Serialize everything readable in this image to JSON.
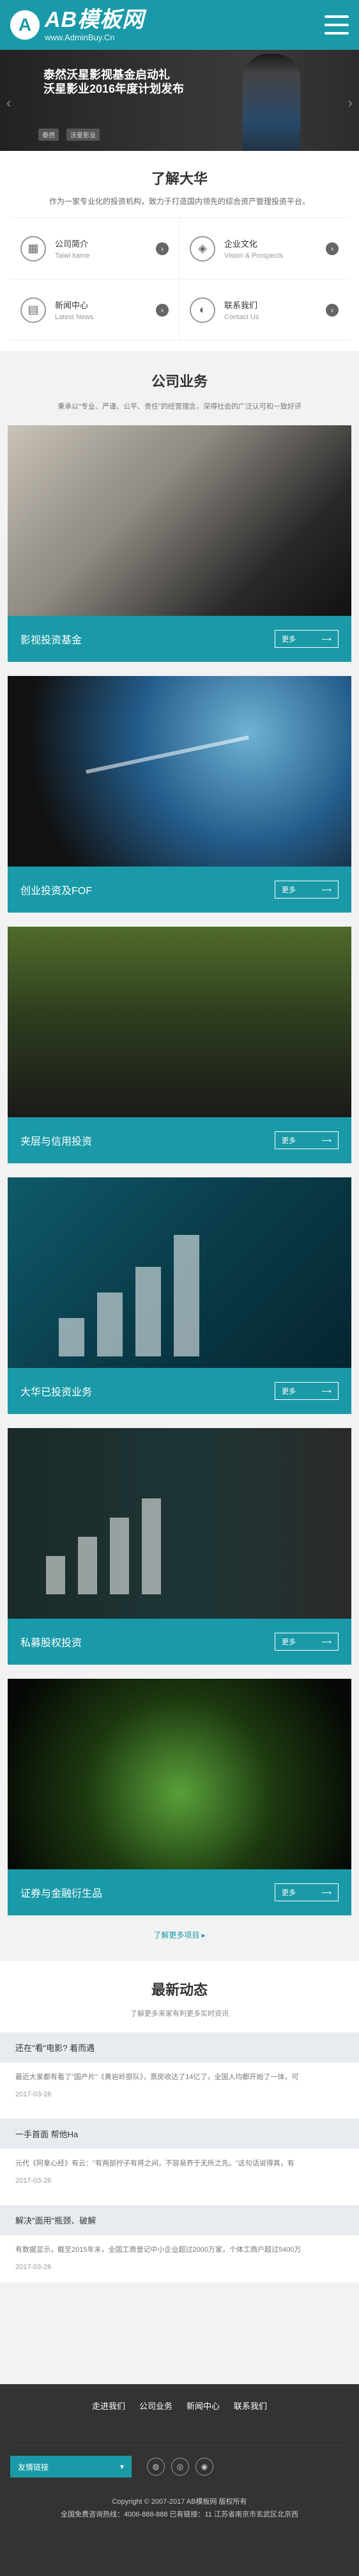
{
  "header": {
    "logo_mark": "A",
    "logo_title": "AB模板网",
    "logo_sub": "www.AdminBuy.Cn"
  },
  "banner": {
    "line1": "泰然沃星影视基金启动礼",
    "line2": "沃星影业2016年度计划发布",
    "logos": [
      "泰然",
      "沃星影业",
      "",
      ""
    ]
  },
  "about": {
    "title": "了解大华",
    "desc": "作为一家专业化的投资机构，致力于打造国内领先的综合资产管理投资平台。",
    "items": [
      {
        "cn": "公司简介",
        "en": "Taiwi kame",
        "icon": "building-icon"
      },
      {
        "cn": "企业文化",
        "en": "Vision & Prospects",
        "icon": "chart-icon"
      },
      {
        "cn": "新闻中心",
        "en": "Latest News",
        "icon": "news-icon"
      },
      {
        "cn": "联系我们",
        "en": "Contact Us",
        "icon": "contact-icon"
      }
    ]
  },
  "business": {
    "title": "公司业务",
    "desc": "秉承以\"专业、严谨、公平、责任\"的经营理念，深得社会的广泛认可和一致好评",
    "more_text": "更多",
    "items": [
      {
        "name": "影视投资基金"
      },
      {
        "name": "创业投资及FOF"
      },
      {
        "name": "夹层与信用投资"
      },
      {
        "name": "大华已投资业务"
      },
      {
        "name": "私募股权投资"
      },
      {
        "name": "证券与金融衍生品"
      }
    ],
    "more_link": "了解更多项目 ▸"
  },
  "news": {
    "title": "最新动态",
    "sub": "了解更多来家有利更多实时资讯",
    "items": [
      {
        "title": "还在\"看\"电影? 着而遇",
        "body": "最近大家都有看了\"国产片\"《黄岩岭部队》，票房收达了14亿了，全国人均都开始了一体，可",
        "date": "2017-03-26"
      },
      {
        "title": "一手首面 帮他Ha",
        "body": "元代《阿拿心经》有云：\"有两部拧子有将之间，不容易养于无所之先。\"这句话说得真，有",
        "date": "2017-03-26"
      },
      {
        "title": "解决\"面用\"瓶颈、破解",
        "body": "有数据显示，截至2015年末，全国工商登记中小企业超过2000万家，个体工商户超过5400万",
        "date": "2017-03-26"
      }
    ]
  },
  "footer": {
    "nav": [
      "走进我们",
      "公司业务",
      "新闻中心",
      "联系我们"
    ],
    "select_label": "友情链接",
    "copyright_line1": "Copyright © 2007-2017 AB模板网 版权所有",
    "copyright_line2": "全国免费咨询热线：4006-888-888 已有链接：11  江苏省南京市玄武区北京西"
  }
}
